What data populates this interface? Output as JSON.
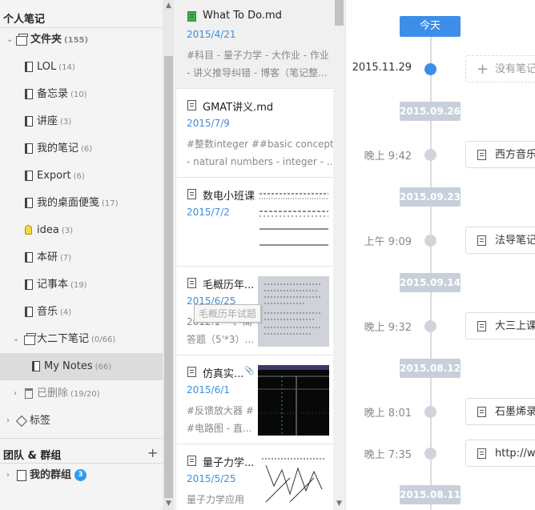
{
  "sidebar": {
    "personal_header": "个人笔记",
    "folder": {
      "label": "文件夹",
      "count": "(155)"
    },
    "notebooks": [
      {
        "label": "LOL",
        "count": "(14)"
      },
      {
        "label": "备忘录",
        "count": "(10)"
      },
      {
        "label": "讲座",
        "count": "(3)"
      },
      {
        "label": "我的笔记",
        "count": "(6)"
      },
      {
        "label": "Export",
        "count": "(6)"
      },
      {
        "label": "我的桌面便笺",
        "count": "(17)"
      },
      {
        "label": "idea",
        "count": "(3)"
      },
      {
        "label": "本研",
        "count": "(7)"
      },
      {
        "label": "记事本",
        "count": "(19)"
      },
      {
        "label": "音乐",
        "count": "(4)"
      }
    ],
    "subfolder": {
      "label": "大二下笔记",
      "count": "(0/66)"
    },
    "my_notes": {
      "label": "My Notes",
      "count": "(66)"
    },
    "deleted": {
      "label": "已删除",
      "count": "(19/20)"
    },
    "tags_label": "标签",
    "team_header": "团队 & 群组",
    "plus": "+",
    "my_group": {
      "label": "我的群组",
      "badge": "3"
    }
  },
  "notelist": {
    "notes": [
      {
        "title": "What To Do.md",
        "date": "2015/4/21",
        "line1": "#科目 - 量子力学 - 大作业 - 作业",
        "line2": "- 讲义推导纠错 - 博客（笔记整..."
      },
      {
        "title": "GMAT讲义.md",
        "date": "2015/7/9",
        "line1": "#整数integer ##basic concepts",
        "line2": "- natural numbers - integer - ..."
      },
      {
        "title": "数电小班课",
        "date": "2015/7/2",
        "line1": "",
        "line2": ""
      },
      {
        "title": "毛概历年...",
        "date": "2015/6/25",
        "line1": "2012.1 一、简",
        "line2": "答题（5'*3）..."
      },
      {
        "title": "仿真实...",
        "date": "2015/6/1",
        "line1": "#反馈放大器 #",
        "line2": "#电路图 - 直..."
      },
      {
        "title": "量子力学...",
        "date": "2015/5/25",
        "line1": "量子力学应用",
        "line2": ""
      }
    ],
    "tooltip": "毛概历年试题"
  },
  "timeline": {
    "today": "今天",
    "entries": [
      {
        "kind": "item",
        "time": "2015.11.29",
        "text": "没有笔记",
        "empty": true
      },
      {
        "kind": "chip",
        "text": "2015.09.26"
      },
      {
        "kind": "item",
        "time": "晚上 9:42",
        "text": "西方音乐"
      },
      {
        "kind": "chip",
        "text": "2015.09.23"
      },
      {
        "kind": "item",
        "time": "上午 9:09",
        "text": "法导笔记"
      },
      {
        "kind": "chip",
        "text": "2015.09.14"
      },
      {
        "kind": "item",
        "time": "晚上 9:32",
        "text": "大三上课"
      },
      {
        "kind": "chip",
        "text": "2015.08.12"
      },
      {
        "kind": "item",
        "time": "晚上 8:01",
        "text": "石墨烯录"
      },
      {
        "kind": "item",
        "time": "晚上 7:35",
        "text": "http://w"
      },
      {
        "kind": "chip",
        "text": "2015.08.11"
      }
    ]
  },
  "colors": {
    "accent": "#3d8ee8",
    "date_blue": "#3d8fd8",
    "badge": "#2d9bf0",
    "chip": "#c7d0da"
  }
}
